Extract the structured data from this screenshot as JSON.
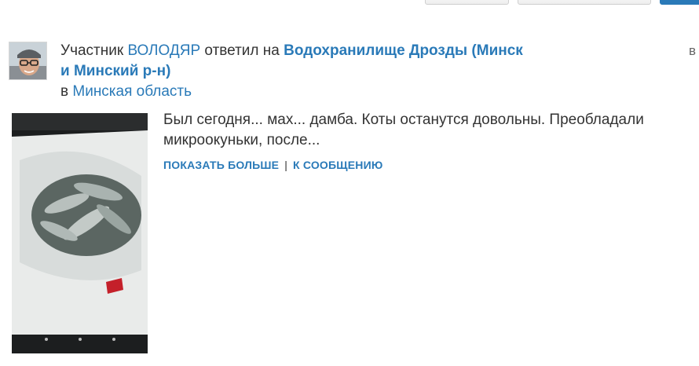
{
  "activity": {
    "prefix": "Участник",
    "user_name": "ВОЛОДЯР",
    "action": "ответил на",
    "topic_title": "Водохранилище Дрозды (Минск и Минский р-н)",
    "in_label": "в",
    "forum_name": "Минская область",
    "corner_text": "в"
  },
  "post": {
    "excerpt": "Был сегодня... мах... дамба. Коты останутся довольны. Преобладали микроокуньки, после...",
    "show_more_label": "Показать больше",
    "separator": "|",
    "to_message_label": "К сообщению"
  },
  "colors": {
    "link": "#2a7ab8",
    "text": "#333333"
  }
}
